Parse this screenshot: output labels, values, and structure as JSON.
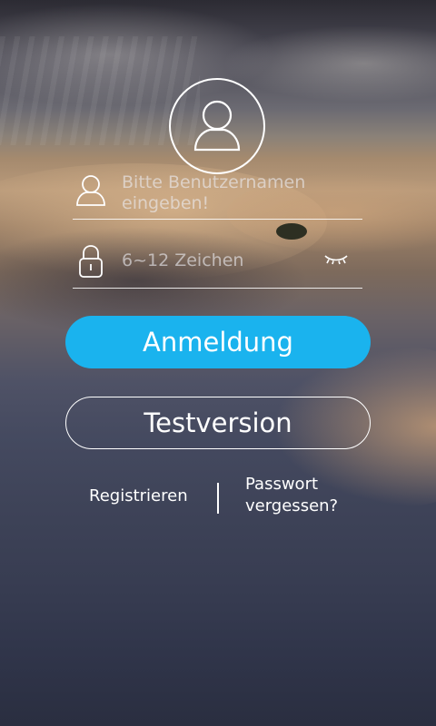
{
  "login": {
    "username_placeholder": "Bitte Benutzernamen eingeben!",
    "password_placeholder": "6~12 Zeichen",
    "login_button": "Anmeldung",
    "trial_button": "Testversion",
    "register_link": "Registrieren",
    "forgot_link": "Passwort vergessen?"
  },
  "icons": {
    "avatar": "user-avatar-icon",
    "username": "user-icon",
    "password": "lock-icon",
    "visibility": "eye-closed-icon"
  },
  "colors": {
    "primary": "#1ab3ee",
    "text": "#ffffff"
  }
}
